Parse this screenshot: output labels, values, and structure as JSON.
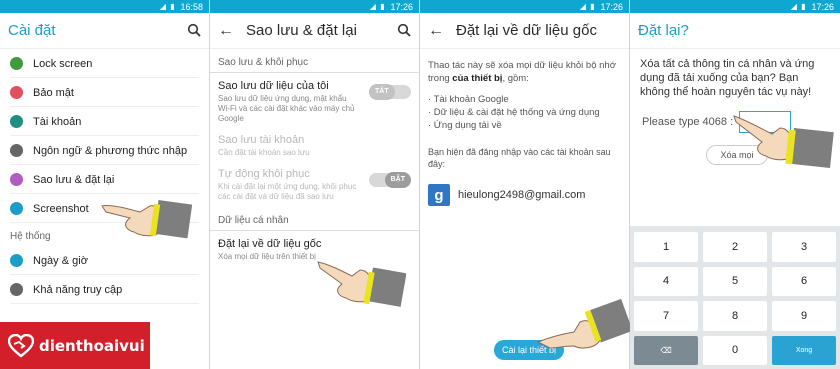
{
  "status": {
    "time1": "16:58",
    "time2": "17:26",
    "time3": "17:26",
    "time4": "17:26"
  },
  "panel1": {
    "title": "Cài đặt",
    "items": [
      {
        "label": "Lock screen",
        "color": "#3f9b3f",
        "icon": "lock-screen-icon"
      },
      {
        "label": "Bảo mật",
        "color": "#e0505f",
        "icon": "padlock-icon"
      },
      {
        "label": "Tài khoản",
        "color": "#1f8f7f",
        "icon": "person-icon"
      },
      {
        "label": "Ngôn ngữ & phương thức nhập",
        "color": "#666666",
        "icon": "language-icon"
      },
      {
        "label": "Sao lưu & đặt lại",
        "color": "#b05cc0",
        "icon": "backup-icon"
      },
      {
        "label": "Screenshot",
        "color": "#1c9dc8",
        "icon": "screenshot-icon"
      }
    ],
    "section": "Hệ thống",
    "items2": [
      {
        "label": "Ngày & giờ",
        "color": "#1c9dc8",
        "icon": "clock-icon"
      },
      {
        "label": "Khả năng truy cập",
        "color": "#666666",
        "icon": "hand-icon"
      }
    ]
  },
  "panel2": {
    "title": "Sao lưu & đặt lại",
    "sec1": "Sao lưu & khôi phục",
    "backup_title": "Sao lưu dữ liệu của tôi",
    "backup_desc": "Sao lưu dữ liệu ứng dụng, mật khẩu Wi-Fi và các cài đặt khác vào máy chủ Google",
    "backup_toggle": "TẮT",
    "account_title": "Sao lưu tài khoản",
    "account_desc": "Cần đặt tài khoản sao lưu",
    "restore_title": "Tự động khôi phục",
    "restore_desc": "Khi cài đặt lại một ứng dụng, khôi phục các cài đặt và dữ liệu đã sao lưu",
    "restore_toggle": "BẬT",
    "sec2": "Dữ liệu cá nhân",
    "reset_title": "Đặt lại về dữ liệu gốc",
    "reset_desc": "Xóa mọi dữ liệu trên thiết bị"
  },
  "panel3": {
    "title": "Đặt lại về dữ liệu gốc",
    "intro": "Thao tác này sẽ xóa mọi dữ liệu khỏi bộ nhớ trong ",
    "intro_bold": "của thiết bị",
    "intro_end": ", gồm:",
    "list": [
      "· Tài khoản Google",
      "· Dữ liệu & cài đặt hệ thống và ứng dụng",
      "· Ứng dụng tải về"
    ],
    "note": "Bạn hiện đã đăng nhập vào các tài khoản sau đây:",
    "email": "hieulong2498@gmail.com",
    "button": "Cài lại thiết bị"
  },
  "panel4": {
    "title": "Đặt lại?",
    "message": "Xóa tất cả thông tin cá nhân và ứng dụng đã tải xuống của bạn? Bạn không thể hoàn nguyên tác vụ này!",
    "type_label": "Please type 4068 :",
    "cancel": "Xóa mọi",
    "keys": [
      "1",
      "2",
      "3",
      "4",
      "5",
      "6",
      "7",
      "8",
      "9",
      "",
      "0",
      "Xong"
    ]
  },
  "logo": {
    "text": "dienthoaivui"
  },
  "colors": {
    "accent": "#0fa7cf",
    "brand": "#d21f2a"
  }
}
